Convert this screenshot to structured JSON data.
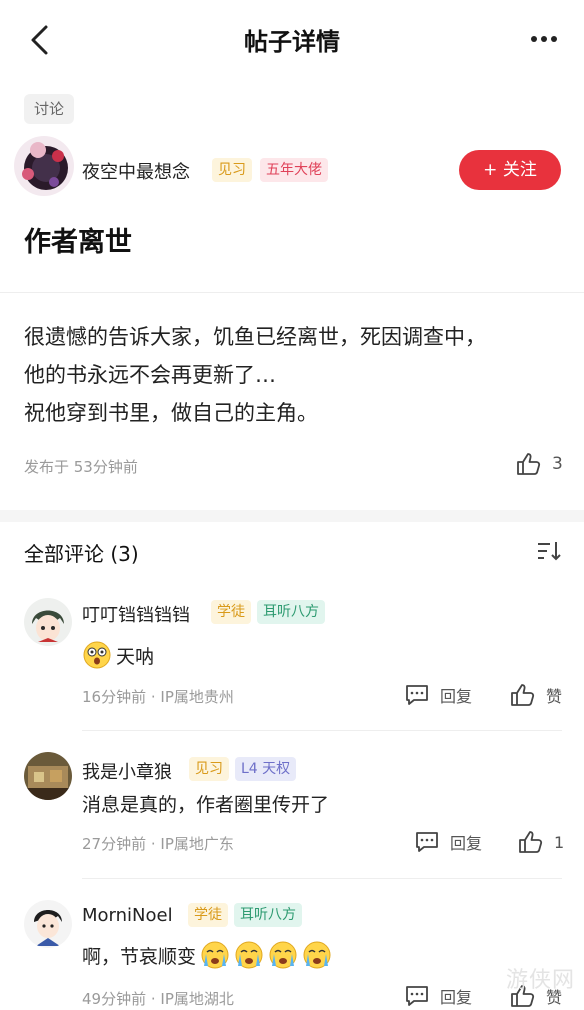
{
  "header": {
    "title": "帖子详情"
  },
  "post": {
    "tag": "讨论",
    "author": "夜空中最想念",
    "badges": [
      "见习",
      "五年大佬"
    ],
    "follow_label": "+ 关注",
    "title": "作者离世",
    "content_lines": [
      "很遗憾的告诉大家，饥鱼已经离世，死因调查中，",
      "他的书永远不会再更新了…",
      "祝他穿到书里，做自己的主角。"
    ],
    "meta": "发布于 53分钟前",
    "like_count": "3"
  },
  "comments": {
    "title": "全部评论 (3)",
    "items": [
      {
        "name": "叮叮铛铛铛铛",
        "badges": [
          "学徒",
          "耳听八方"
        ],
        "text": "天呐",
        "meta": "16分钟前 · IP属地贵州",
        "reply_label": "回复",
        "like_label": "赞"
      },
      {
        "name": "我是小章狼",
        "badges": [
          "见习",
          "L4 天权"
        ],
        "text": "消息是真的，作者圈里传开了",
        "meta": "27分钟前 · IP属地广东",
        "reply_label": "回复",
        "like_label": "1"
      },
      {
        "name": "MorniNoel",
        "badges": [
          "学徒",
          "耳听八方"
        ],
        "text": "啊，节哀顺变",
        "meta": "49分钟前 · IP属地湖北",
        "reply_label": "回复",
        "like_label": "赞"
      }
    ]
  },
  "watermark": "游侠网"
}
